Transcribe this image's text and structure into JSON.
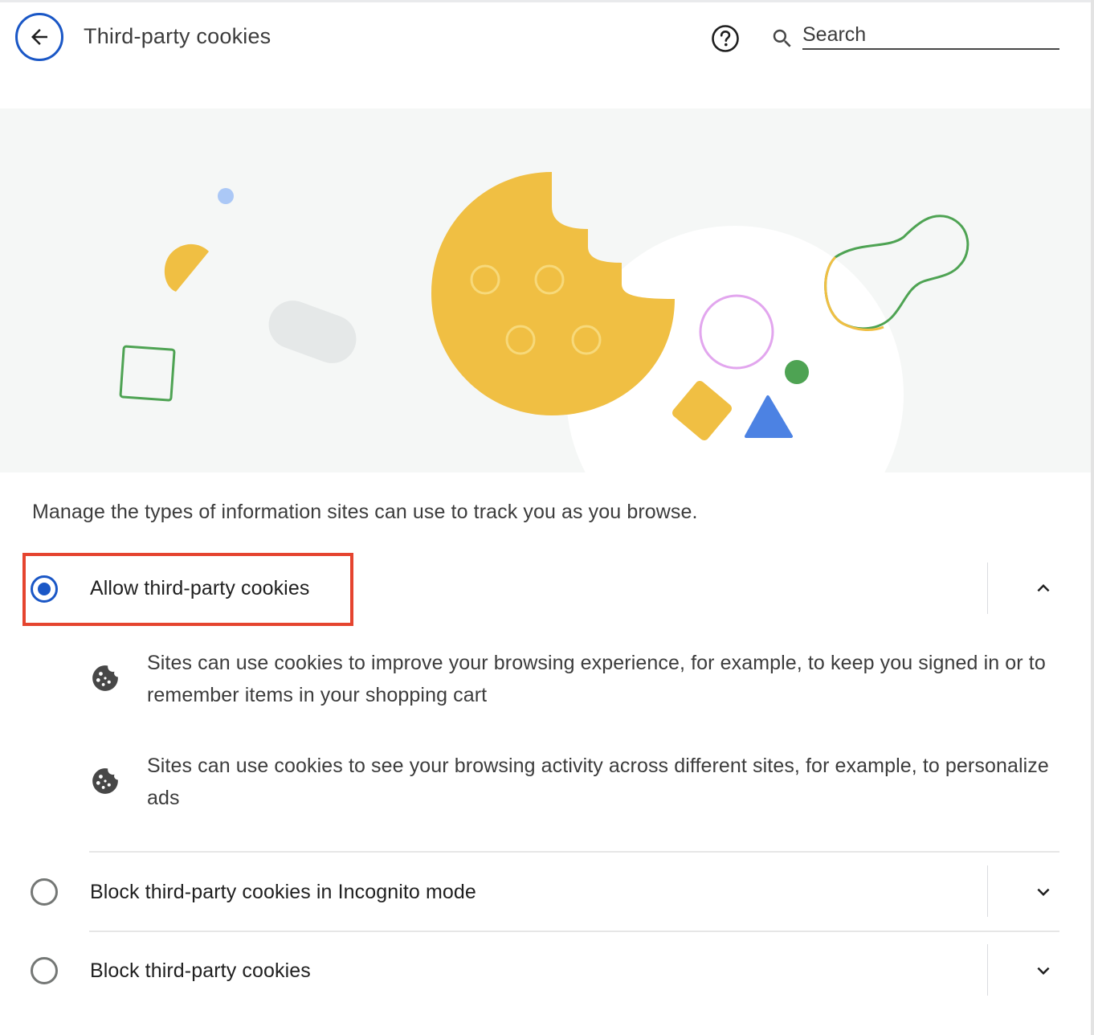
{
  "header": {
    "title": "Third-party cookies",
    "back_icon": "arrow-back-icon",
    "help_icon": "help-circle-icon",
    "search_icon": "search-icon",
    "search_placeholder": "Search"
  },
  "banner": {
    "illustration": "cookie-illustration",
    "colors": {
      "background": "#f5f7f6",
      "cookie": "#f0bf43",
      "green": "#4ea353",
      "blue": "#4c82e3",
      "pink": "#e2a6ee",
      "light_blue": "#abc8f6",
      "gray": "#e5e8e8"
    }
  },
  "description": "Manage the types of information sites can use to track you as you browse.",
  "options": [
    {
      "label": "Allow third-party cookies",
      "selected": true,
      "expanded": true,
      "chevron_icon": "chevron-up-icon",
      "details": [
        {
          "icon": "cookie-icon",
          "text": "Sites can use cookies to improve your browsing experience, for example, to keep you signed in or to remember items in your shopping cart"
        },
        {
          "icon": "cookie-icon",
          "text": "Sites can use cookies to see your browsing activity across different sites, for example, to personalize ads"
        }
      ]
    },
    {
      "label": "Block third-party cookies in Incognito mode",
      "selected": false,
      "expanded": false,
      "chevron_icon": "chevron-down-icon"
    },
    {
      "label": "Block third-party cookies",
      "selected": false,
      "expanded": false,
      "chevron_icon": "chevron-down-icon"
    }
  ],
  "theme": {
    "accent": "#1a57c6",
    "highlight": "#e5442f"
  }
}
